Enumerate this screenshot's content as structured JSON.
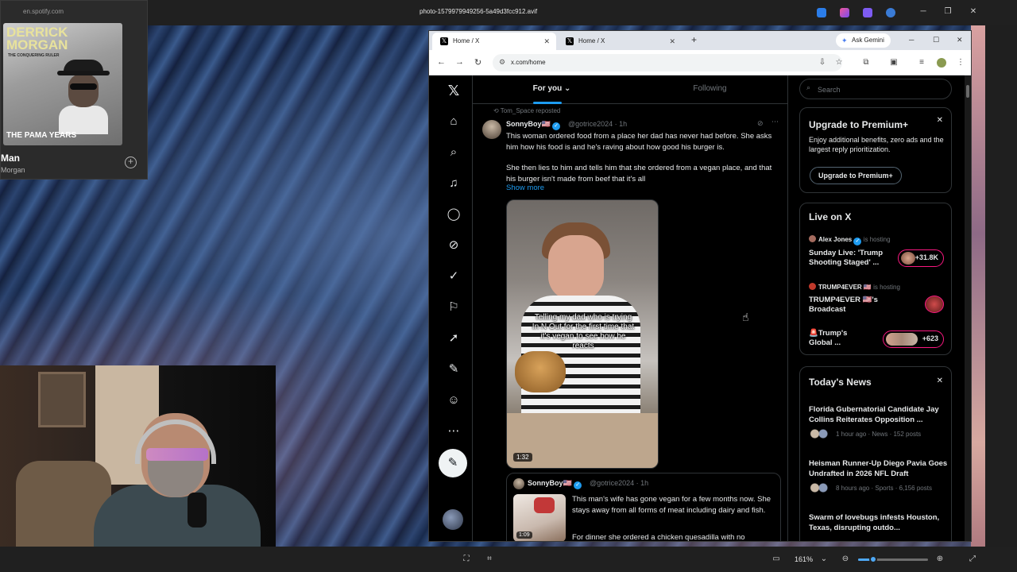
{
  "viewer": {
    "title": "photo-1579979949256-5a49d3fcc912.avif",
    "zoom": "161%",
    "zoom_fraction": 0.22
  },
  "spotify": {
    "url": "en.spotify.com",
    "album_artist": "DERRICK MORGAN",
    "album_subtitle": "THE CONQUERING RULER",
    "album_bottom": "THE PAMA YEARS",
    "track_title": "Man",
    "track_artist": "Morgan"
  },
  "browser": {
    "tabs": [
      {
        "label": "Home / X"
      },
      {
        "label": "Home / X"
      }
    ],
    "ask_gemini": "Ask Gemini",
    "url": "x.com/home"
  },
  "x": {
    "tabs": {
      "for_you": "For you",
      "following": "Following"
    },
    "tweet": {
      "repost_line": "Tom_Space reposted",
      "name": "SonnyBoy🇺🇸",
      "handle_time": "@gotrice2024 · 1h",
      "text_1": "This woman ordered food from a place her dad has never had before. She asks him how his food is and he's raving about how good his burger is.",
      "text_2": "She then lies to him and tells him that she ordered from a vegan place, and that his burger isn't made from beef that it's all",
      "show_more": "Show more",
      "media_caption": "Telling my dad who is trying In N Out for the first time that it's vegan to see how he reacts",
      "media_duration": "1:32"
    },
    "quote": {
      "name": "SonnyBoy🇺🇸",
      "handle_time": "@gotrice2024 · 1h",
      "text": "This man's wife has gone vegan for a few months now. She stays away from all forms of meat including dairy and fish.",
      "text_cut": "For dinner she ordered a chicken quesadilla with no",
      "duration": "1:09"
    },
    "sidebar": {
      "search_placeholder": "Search",
      "premium": {
        "title": "Upgrade to Premium+",
        "desc": "Enjoy additional benefits, zero ads and the largest reply prioritization.",
        "button": "Upgrade to Premium+"
      },
      "live": {
        "title": "Live on X",
        "items": [
          {
            "host": "Alex Jones",
            "status": "is hosting",
            "title": "Sunday Live: 'Trump Shooting Staged' ...",
            "count": "+31.8K"
          },
          {
            "host": "TRUMP4EVER 🇺🇸",
            "status": "is hosting",
            "title": "TRUMP4EVER 🇺🇸's Broadcast",
            "count": ""
          },
          {
            "host": "",
            "status": "",
            "title": "🚨Trump's Global ...",
            "count": "+623"
          }
        ]
      },
      "news": {
        "title": "Today's News",
        "items": [
          {
            "title": "Florida Gubernatorial Candidate Jay Collins Reiterates Opposition ...",
            "meta": "1 hour ago · News · 152 posts"
          },
          {
            "title": "Heisman Runner-Up Diego Pavia Goes Undrafted in 2026 NFL Draft",
            "meta": "8 hours ago · Sports · 6,156 posts"
          },
          {
            "title": "Swarm of lovebugs infests Houston, Texas, disrupting outdo...",
            "meta": ""
          }
        ]
      }
    }
  },
  "icons": {
    "nav": [
      "x-logo",
      "home-icon",
      "search-icon",
      "bell-icon",
      "chat-icon",
      "grok-icon",
      "verified-icon",
      "bookmark-icon",
      "rocket-icon",
      "edit-icon",
      "profile-icon",
      "more-icon"
    ]
  },
  "colors": {
    "accent": "#1d9bf0",
    "live": "#f91880",
    "background": "#000000"
  }
}
